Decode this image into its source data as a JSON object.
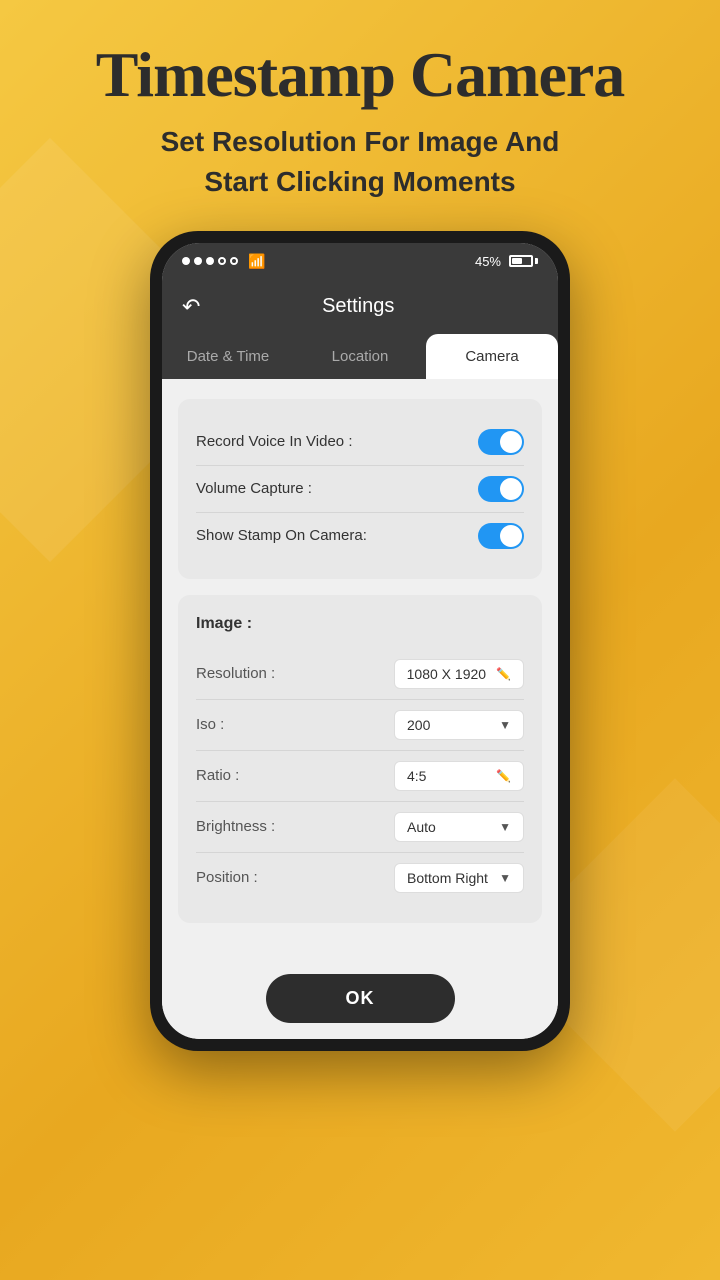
{
  "header": {
    "app_title": "Timestamp Camera",
    "subtitle_line1": "Set Resolution For Image And",
    "subtitle_line2": "Start Clicking Moments"
  },
  "status_bar": {
    "battery_percent": "45%"
  },
  "screen": {
    "header_title": "Settings",
    "back_label": "←",
    "tabs": [
      {
        "id": "date-time",
        "label": "Date & Time",
        "active": false
      },
      {
        "id": "location",
        "label": "Location",
        "active": false
      },
      {
        "id": "camera",
        "label": "Camera",
        "active": true
      }
    ],
    "toggles": [
      {
        "id": "record-voice",
        "label": "Record Voice In Video :",
        "on": true
      },
      {
        "id": "volume-capture",
        "label": "Volume Capture :",
        "on": true
      },
      {
        "id": "show-stamp",
        "label": "Show Stamp On Camera:",
        "on": true
      }
    ],
    "image_section_title": "Image :",
    "settings": [
      {
        "id": "resolution",
        "label": "Resolution :",
        "value": "1080 X 1920",
        "icon": "pencil"
      },
      {
        "id": "iso",
        "label": "Iso :",
        "value": "200",
        "icon": "dropdown"
      },
      {
        "id": "ratio",
        "label": "Ratio :",
        "value": "4:5",
        "icon": "pencil"
      },
      {
        "id": "brightness",
        "label": "Brightness :",
        "value": "Auto",
        "icon": "dropdown"
      },
      {
        "id": "position",
        "label": "Position :",
        "value": "Bottom Right",
        "icon": "dropdown"
      }
    ],
    "ok_button_label": "OK"
  }
}
